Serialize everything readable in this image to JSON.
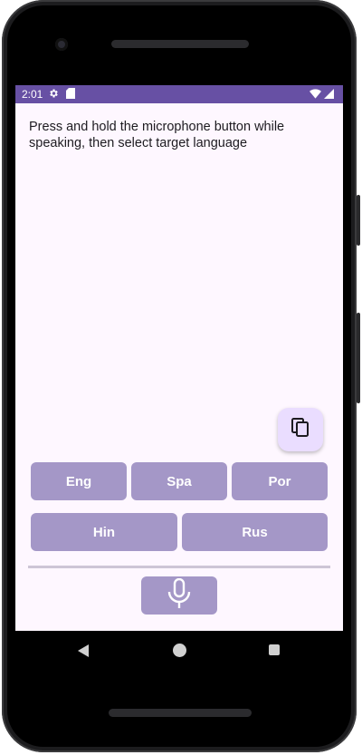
{
  "status_bar": {
    "time": "2:01",
    "icons": [
      "gear-icon",
      "sd-card-icon",
      "wifi-icon",
      "cell-signal-icon"
    ]
  },
  "instructions": "Press and hold the microphone button while speaking, then select target language",
  "copy_button": {
    "icon": "copy-icon"
  },
  "languages": {
    "row1": [
      "Eng",
      "Spa",
      "Por"
    ],
    "row2": [
      "Hin",
      "Rus"
    ]
  },
  "mic_button": {
    "icon": "microphone-icon"
  },
  "nav": {
    "icons": [
      "back-icon",
      "home-icon",
      "recents-icon"
    ]
  },
  "colors": {
    "status_bar": "#6750a4",
    "screen_bg": "#fef7ff",
    "button": "#a497c7",
    "fab": "#eaddff"
  }
}
